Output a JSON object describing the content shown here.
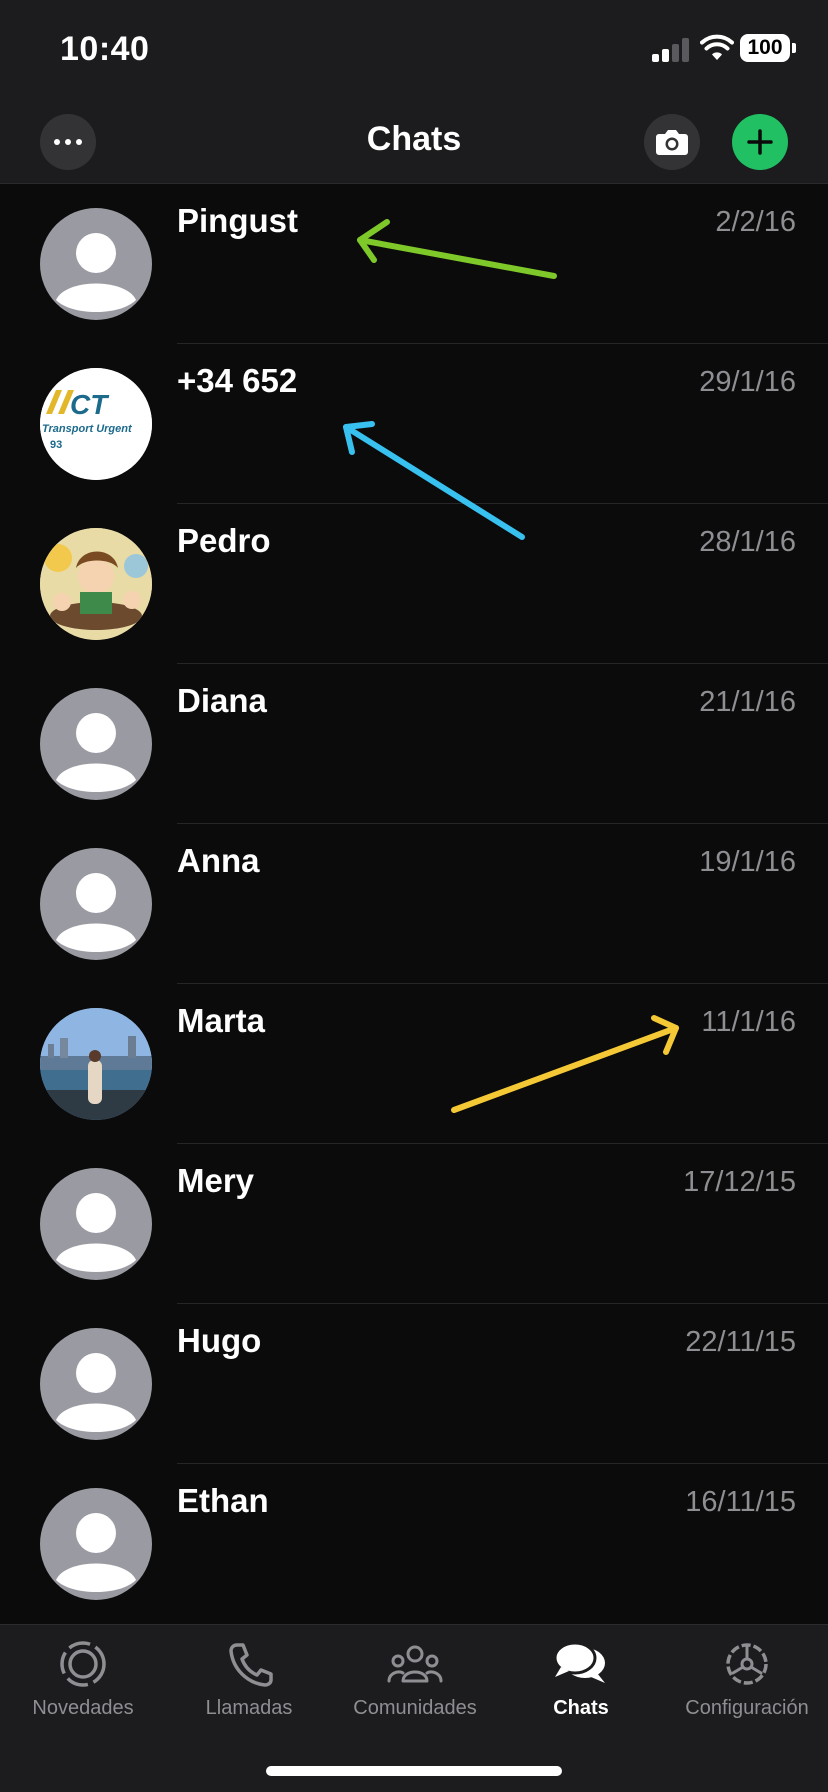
{
  "status_bar": {
    "time": "10:40",
    "battery": "100"
  },
  "header": {
    "title": "Chats"
  },
  "chats": [
    {
      "name": "Pingust",
      "date": "2/2/16",
      "avatar": "default-avatar-icon"
    },
    {
      "name": "+34 652",
      "date": "29/1/16",
      "avatar": "photo-logo"
    },
    {
      "name": "Pedro",
      "date": "28/1/16",
      "avatar": "photo-cartoon"
    },
    {
      "name": "Diana",
      "date": "21/1/16",
      "avatar": "default-avatar-icon"
    },
    {
      "name": "Anna",
      "date": "19/1/16",
      "avatar": "default-avatar-icon"
    },
    {
      "name": "Marta",
      "date": "11/1/16",
      "avatar": "photo-waterfront"
    },
    {
      "name": "Mery",
      "date": "17/12/15",
      "avatar": "default-avatar-icon"
    },
    {
      "name": "Hugo",
      "date": "22/11/15",
      "avatar": "default-avatar-icon"
    },
    {
      "name": "Ethan",
      "date": "16/11/15",
      "avatar": "default-avatar-icon"
    }
  ],
  "avatar_logo_text": {
    "line1": "MCT",
    "line2": "Transport Urgent",
    "line3": "93"
  },
  "annotations": [
    {
      "target": "Pingust",
      "color": "#7ec82a"
    },
    {
      "target": "+34 652",
      "color": "#38c0ee"
    },
    {
      "target": "11/1/16",
      "color": "#f5c935"
    }
  ],
  "tabs": [
    {
      "label": "Novedades",
      "icon": "status-icon",
      "active": false
    },
    {
      "label": "Llamadas",
      "icon": "phone-icon",
      "active": false
    },
    {
      "label": "Comunidades",
      "icon": "communities-icon",
      "active": false
    },
    {
      "label": "Chats",
      "icon": "chats-icon",
      "active": true
    },
    {
      "label": "Configuración",
      "icon": "settings-icon",
      "active": false
    }
  ],
  "colors": {
    "accent": "#21c063",
    "background": "#0b0b0b",
    "bar": "#1c1c1e",
    "secondary_text": "#8e8e93"
  }
}
